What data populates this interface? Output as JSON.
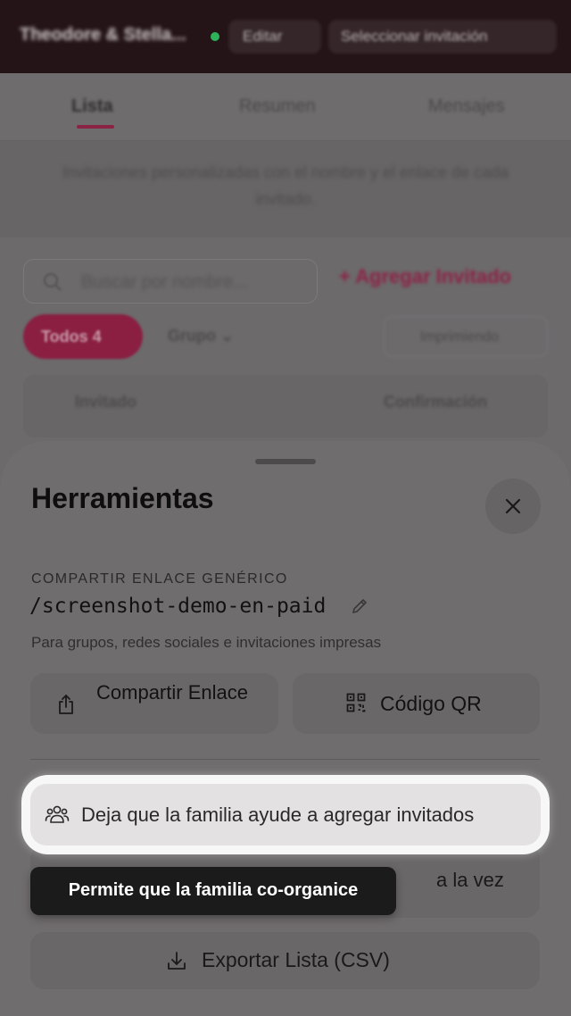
{
  "topbar": {
    "event_name": "Theodore & Stella...",
    "edit_label": "Editar",
    "template_label": "Seleccionar invitación"
  },
  "tabs": [
    {
      "label": "Lista"
    },
    {
      "label": "Resumen"
    },
    {
      "label": "Mensajes"
    }
  ],
  "info_text": "Invitaciones personalizadas con el nombre y el enlace de cada invitado.",
  "search": {
    "placeholder": "Buscar por nombre..."
  },
  "add_guest_label": "Agregar Invitado",
  "filters": {
    "all_label": "Todos 4",
    "group_label": "Grupo",
    "print_label": "Imprimiendo"
  },
  "table": {
    "columns": [
      "Invitado",
      "Confirmación"
    ]
  },
  "sheet": {
    "title": "Herramientas",
    "share_label": "COMPARTIR ENLACE GENÉRICO",
    "share_link": "/screenshot-demo-en-paid",
    "share_hint": "Para grupos, redes sociales e invitaciones impresas",
    "share_button_label": "Compartir Enlace",
    "qr_button_label": "Código QR",
    "family_button_label": "Deja que la familia ayude a agregar invitados",
    "bulk_button_label_visible": "a la vez",
    "export_button_label": "Exportar Lista (CSV)",
    "tooltip_text": "Permite que la familia co-organice"
  },
  "colors": {
    "accent": "#e4226b",
    "tooltip_bg": "#1c1b1c"
  }
}
